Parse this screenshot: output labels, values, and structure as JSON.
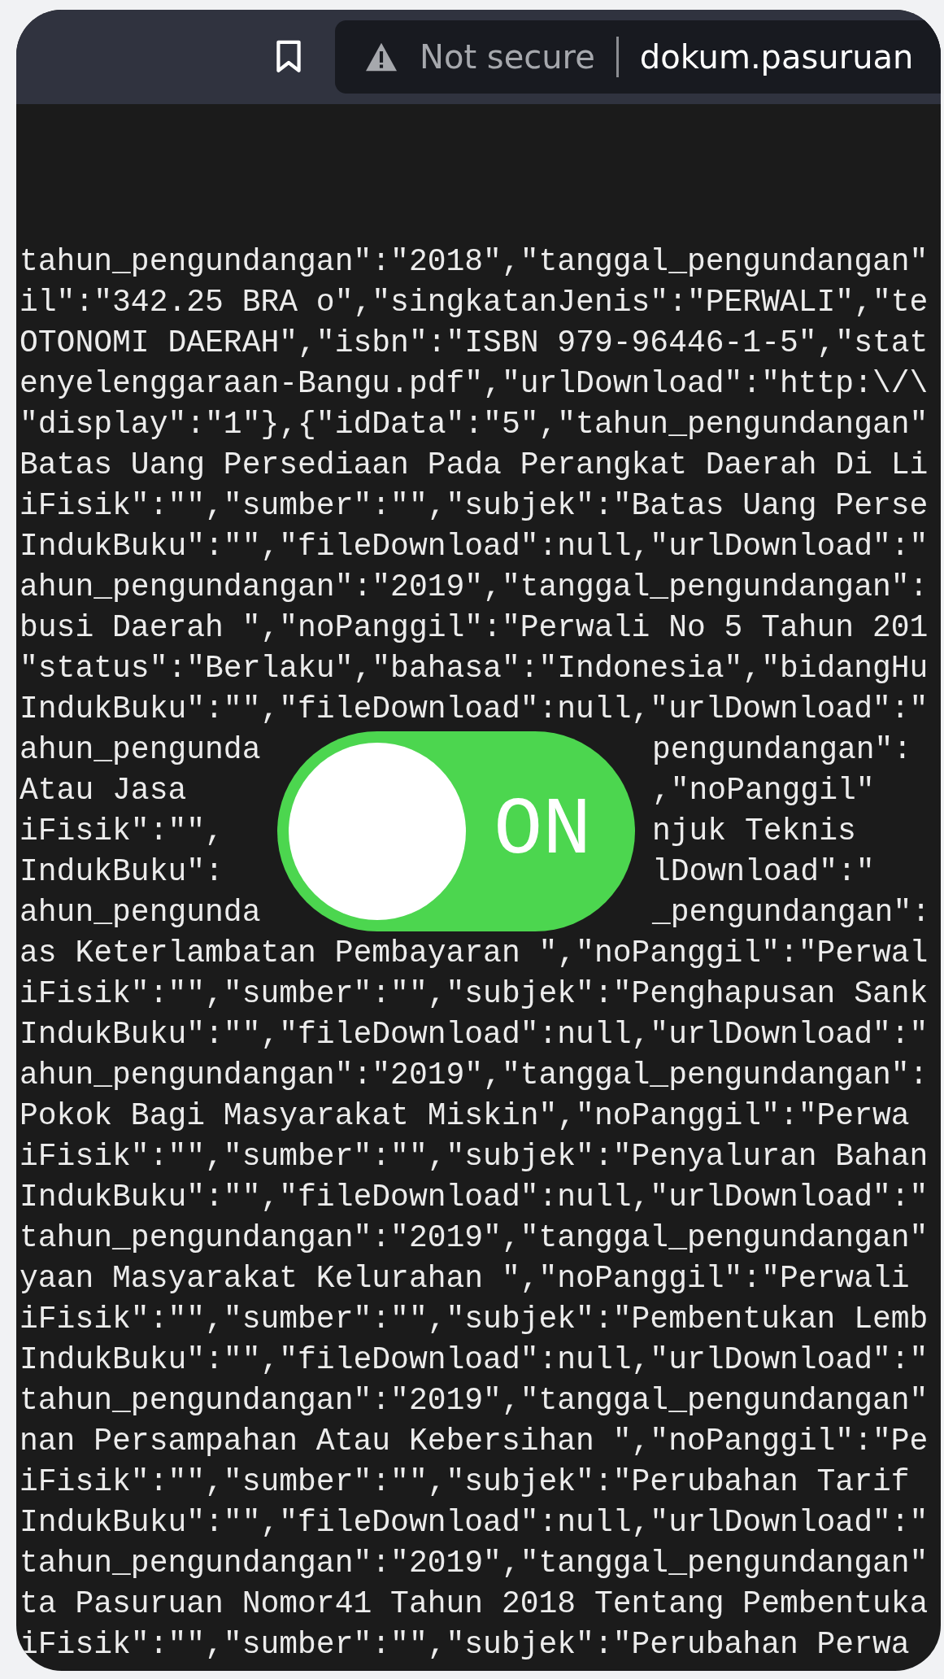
{
  "browser": {
    "security_label": "Not secure",
    "url": "dokum.pasuruan"
  },
  "lines": [
    {
      "left": "tahun_pengundangan\":\"2018\",\"tanggal_pengundangan\""
    },
    {
      "left": "il\":\"342.25 BRA o\",\"singkatanJenis\":\"PERWALI\",\"te"
    },
    {
      "left": "OTONOMI DAERAH\",\"isbn\":\"ISBN 979-96446-1-5\",\"stat"
    },
    {
      "left": "enyelenggaraan-Bangu.pdf\",\"urlDownload\":\"http:\\/\\"
    },
    {
      "left": "\"display\":\"1\"},{\"idData\":\"5\",\"tahun_pengundangan\""
    },
    {
      "left": "Batas Uang Persediaan Pada Perangkat Daerah Di Li"
    },
    {
      "left": "iFisik\":\"\",\"sumber\":\"\",\"subjek\":\"Batas Uang Perse"
    },
    {
      "left": "IndukBuku\":\"\",\"fileDownload\":null,\"urlDownload\":\""
    },
    {
      "left": "ahun_pengundangan\":\"2019\",\"tanggal_pengundangan\":"
    },
    {
      "left": "busi Daerah \",\"noPanggil\":\"Perwali No 5 Tahun 201"
    },
    {
      "left": "\"status\":\"Berlaku\",\"bahasa\":\"Indonesia\",\"bidangHu"
    },
    {
      "left": "IndukBuku\":\"\",\"fileDownload\":null,\"urlDownload\":\""
    },
    {
      "left": "ahun_pengunda",
      "right": "pengundangan\":"
    },
    {
      "left": "Atau Jasa",
      "right": ",\"noPanggil\""
    },
    {
      "left": "iFisik\":\"\",",
      "right": "njuk Teknis"
    },
    {
      "left": "IndukBuku\":",
      "right": "lDownload\":\""
    },
    {
      "left": "ahun_pengunda",
      "right": "_pengundangan\":"
    },
    {
      "left": "as Keterlambatan Pembayaran \",\"noPanggil\":\"Perwal"
    },
    {
      "left": "iFisik\":\"\",\"sumber\":\"\",\"subjek\":\"Penghapusan Sank"
    },
    {
      "left": "IndukBuku\":\"\",\"fileDownload\":null,\"urlDownload\":\""
    },
    {
      "left": "ahun_pengundangan\":\"2019\",\"tanggal_pengundangan\":"
    },
    {
      "left": "Pokok Bagi Masyarakat Miskin\",\"noPanggil\":\"Perwa"
    },
    {
      "left": "iFisik\":\"\",\"sumber\":\"\",\"subjek\":\"Penyaluran Bahan"
    },
    {
      "left": "IndukBuku\":\"\",\"fileDownload\":null,\"urlDownload\":\""
    },
    {
      "left": "tahun_pengundangan\":\"2019\",\"tanggal_pengundangan\""
    },
    {
      "left": "yaan Masyarakat Kelurahan \",\"noPanggil\":\"Perwali"
    },
    {
      "left": "iFisik\":\"\",\"sumber\":\"\",\"subjek\":\"Pembentukan Lemb"
    },
    {
      "left": "IndukBuku\":\"\",\"fileDownload\":null,\"urlDownload\":\""
    },
    {
      "left": "tahun_pengundangan\":\"2019\",\"tanggal_pengundangan\""
    },
    {
      "left": "nan Persampahan Atau Kebersihan \",\"noPanggil\":\"Pe"
    },
    {
      "left": "iFisik\":\"\",\"sumber\":\"\",\"subjek\":\"Perubahan Tarif"
    },
    {
      "left": "IndukBuku\":\"\",\"fileDownload\":null,\"urlDownload\":\""
    },
    {
      "left": "tahun_pengundangan\":\"2019\",\"tanggal_pengundangan\""
    },
    {
      "left": "ta Pasuruan Nomor41 Tahun 2018 Tentang Pembentuka"
    },
    {
      "left": "iFisik\":\"\",\"sumber\":\"\",\"subjek\":\"Perubahan Perwa"
    }
  ],
  "toggle": {
    "label": "ON",
    "on": true
  }
}
